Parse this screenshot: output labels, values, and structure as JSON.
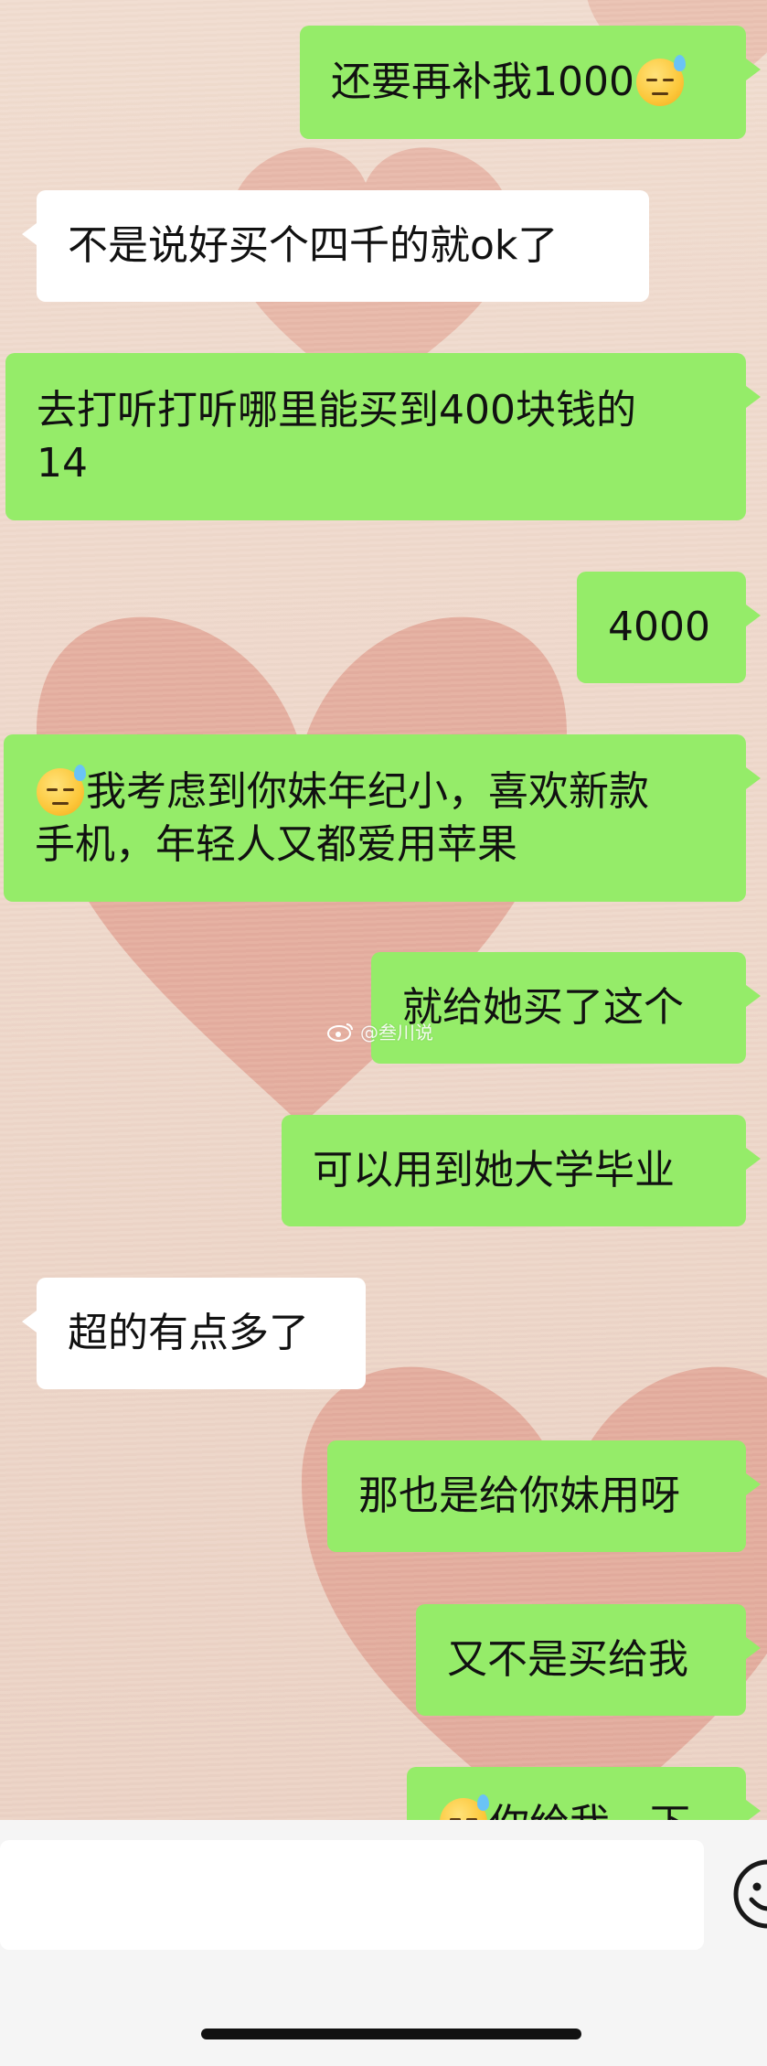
{
  "messages": [
    {
      "side": "out",
      "text": "还要再补我1000",
      "emoji_after": "sweat-smile-icon"
    },
    {
      "side": "in",
      "text": "不是说好买个四千的就ok了"
    },
    {
      "side": "out",
      "line1": "去打听打听哪里能买到400块钱的",
      "line2": "14"
    },
    {
      "side": "out",
      "text": "4000"
    },
    {
      "side": "out",
      "emoji_before": "sweat-smile-icon",
      "line1": "我考虑到你妹年纪小，喜欢新款",
      "line2": "手机，年轻人又都爱用苹果"
    },
    {
      "side": "out",
      "text": "就给她买了这个"
    },
    {
      "side": "out",
      "text": "可以用到她大学毕业"
    },
    {
      "side": "in",
      "text": "超的有点多了"
    },
    {
      "side": "out",
      "text": "那也是给你妹用呀"
    },
    {
      "side": "out",
      "text": "又不是买给我"
    },
    {
      "side": "out",
      "text": "你给我一下",
      "emoji_before": "sweat-smile-icon",
      "truncated": true
    }
  ],
  "watermark": "@叁川说",
  "input": {
    "placeholder": ""
  },
  "colors": {
    "outgoing": "#95ec69",
    "incoming": "#ffffff",
    "background": "#f1dccf"
  }
}
